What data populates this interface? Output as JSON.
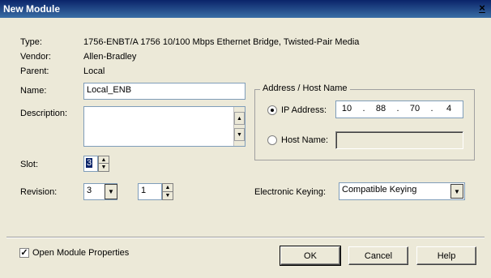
{
  "window": {
    "title": "New Module",
    "close_glyph": "×"
  },
  "info": {
    "type_label": "Type:",
    "type_value": "1756-ENBT/A 1756 10/100 Mbps Ethernet Bridge, Twisted-Pair Media",
    "vendor_label": "Vendor:",
    "vendor_value": "Allen-Bradley",
    "parent_label": "Parent:",
    "parent_value": "Local"
  },
  "form": {
    "name_label": "Name:",
    "name_value": "Local_ENB",
    "description_label": "Description:",
    "description_value": "",
    "slot_label": "Slot:",
    "slot_value": "3",
    "revision_label": "Revision:",
    "revision_major": "3",
    "revision_minor": "1"
  },
  "address": {
    "group_label": "Address / Host Name",
    "ip_label": "IP Address:",
    "ip_octets": [
      "10",
      "88",
      "70",
      "4"
    ],
    "ip_dot": ".",
    "host_label": "Host Name:",
    "host_value": "",
    "selected": "ip"
  },
  "keying": {
    "label": "Electronic Keying:",
    "value": "Compatible Keying"
  },
  "footer": {
    "open_props_label": "Open Module Properties",
    "open_props_checked": true,
    "check_glyph": "✓",
    "ok_label": "OK",
    "cancel_label": "Cancel",
    "help_label": "Help"
  },
  "icons": {
    "spin_up": "▲",
    "spin_down": "▼",
    "dropdown": "▼"
  }
}
